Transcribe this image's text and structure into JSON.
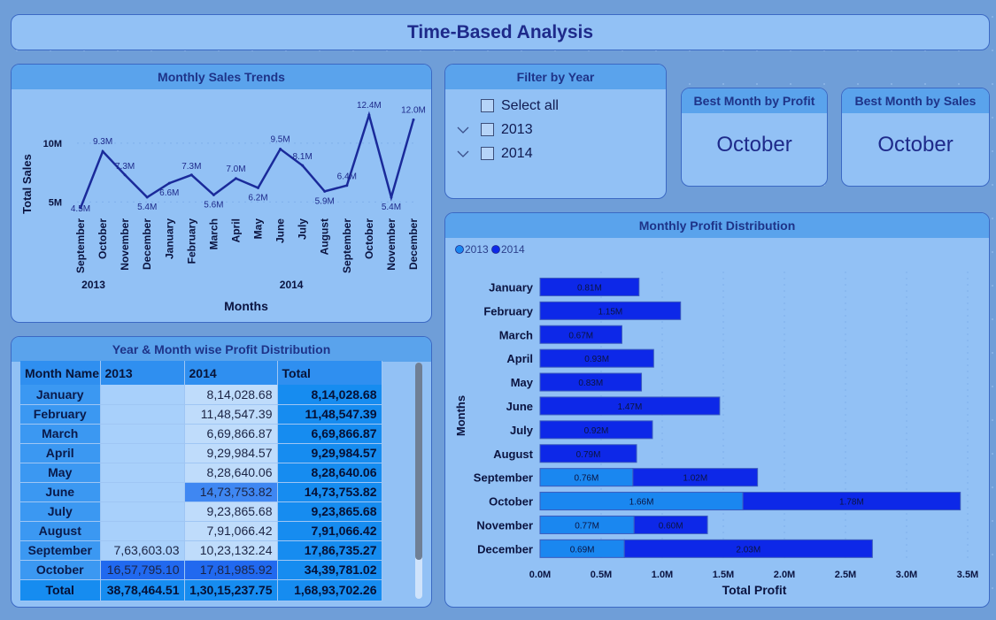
{
  "page": {
    "title": "Time-Based Analysis"
  },
  "sales_chart": {
    "title": "Monthly Sales Trends",
    "chart_data": {
      "type": "line",
      "title": "Monthly Sales Trends",
      "xlabel": "Months",
      "ylabel": "Total Sales",
      "categories": [
        "September",
        "October",
        "November",
        "December",
        "January",
        "February",
        "March",
        "April",
        "May",
        "June",
        "July",
        "August",
        "September",
        "October",
        "November",
        "December"
      ],
      "year_groups": [
        {
          "label": "2013",
          "start": 0,
          "end": 1
        },
        {
          "label": "2014",
          "start": 2,
          "end": 15
        }
      ],
      "values": [
        4.5,
        9.3,
        7.3,
        5.4,
        6.6,
        7.3,
        5.6,
        7.0,
        6.2,
        9.5,
        8.1,
        5.9,
        6.4,
        12.4,
        5.4,
        12.0
      ],
      "labels": [
        "4.5M",
        "9.3M",
        "7.3M",
        "5.4M",
        "6.6M",
        "7.3M",
        "5.6M",
        "7.0M",
        "6.2M",
        "9.5M",
        "8.1M",
        "5.9M",
        "6.4M",
        "12.4M",
        "5.4M",
        "12.0M"
      ],
      "yticks": [
        {
          "v": 5,
          "label": "5M"
        },
        {
          "v": 10,
          "label": "10M"
        }
      ],
      "ylim": [
        4.5,
        12.4
      ],
      "color": "#1a2a9a"
    }
  },
  "filter": {
    "title": "Filter by Year",
    "items": [
      {
        "label": "Select all",
        "expandable": false,
        "checked": false
      },
      {
        "label": "2013",
        "expandable": true,
        "checked": false
      },
      {
        "label": "2014",
        "expandable": true,
        "checked": false
      }
    ]
  },
  "kpi": {
    "profit": {
      "title": "Best Month by Profit",
      "value": "October"
    },
    "sales": {
      "title": "Best Month by Sales",
      "value": "October"
    }
  },
  "table": {
    "title": "Year & Month wise Profit Distribution",
    "columns": [
      "Month Name",
      "2013",
      "2014",
      "Total"
    ],
    "rows": [
      {
        "month": "January",
        "y2013": "",
        "y2014": "8,14,028.68",
        "total": "8,14,028.68"
      },
      {
        "month": "February",
        "y2013": "",
        "y2014": "11,48,547.39",
        "total": "11,48,547.39"
      },
      {
        "month": "March",
        "y2013": "",
        "y2014": "6,69,866.87",
        "total": "6,69,866.87"
      },
      {
        "month": "April",
        "y2013": "",
        "y2014": "9,29,984.57",
        "total": "9,29,984.57"
      },
      {
        "month": "May",
        "y2013": "",
        "y2014": "8,28,640.06",
        "total": "8,28,640.06"
      },
      {
        "month": "June",
        "y2013": "",
        "y2014": "14,73,753.82",
        "total": "14,73,753.82"
      },
      {
        "month": "July",
        "y2013": "",
        "y2014": "9,23,865.68",
        "total": "9,23,865.68"
      },
      {
        "month": "August",
        "y2013": "",
        "y2014": "7,91,066.42",
        "total": "7,91,066.42"
      },
      {
        "month": "September",
        "y2013": "7,63,603.03",
        "y2014": "10,23,132.24",
        "total": "17,86,735.27"
      },
      {
        "month": "October",
        "y2013": "16,57,795.10",
        "y2014": "17,81,985.92",
        "total": "34,39,781.02"
      }
    ],
    "total_row": {
      "month": "Total",
      "y2013": "38,78,464.51",
      "y2014": "1,30,15,237.75",
      "total": "1,68,93,702.26"
    }
  },
  "profit_chart": {
    "title": "Monthly Profit Distribution",
    "chart_data": {
      "type": "bar",
      "orientation": "horizontal",
      "stacked": true,
      "title": "Monthly Profit Distribution",
      "xlabel": "Total Profit",
      "ylabel": "Months",
      "legend": "top-left",
      "categories": [
        "January",
        "February",
        "March",
        "April",
        "May",
        "June",
        "July",
        "August",
        "September",
        "October",
        "November",
        "December"
      ],
      "series": [
        {
          "name": "2013",
          "color": "#1a87f0",
          "values": [
            0,
            0,
            0,
            0,
            0,
            0,
            0,
            0,
            0.76,
            1.66,
            0.77,
            0.69
          ],
          "labels": [
            "",
            "",
            "",
            "",
            "",
            "",
            "",
            "",
            "0.76M",
            "1.66M",
            "0.77M",
            "0.69M"
          ]
        },
        {
          "name": "2014",
          "color": "#0d28e8",
          "values": [
            0.81,
            1.15,
            0.67,
            0.93,
            0.83,
            1.47,
            0.92,
            0.79,
            1.02,
            1.78,
            0.6,
            2.03
          ],
          "labels": [
            "0.81M",
            "1.15M",
            "0.67M",
            "0.93M",
            "0.83M",
            "1.47M",
            "0.92M",
            "0.79M",
            "1.02M",
            "1.78M",
            "0.60M",
            "2.03M"
          ]
        }
      ],
      "xticks": [
        "0.0M",
        "0.5M",
        "1.0M",
        "1.5M",
        "2.0M",
        "2.5M",
        "3.0M",
        "3.5M"
      ],
      "xlim": [
        0,
        3.5
      ]
    }
  }
}
